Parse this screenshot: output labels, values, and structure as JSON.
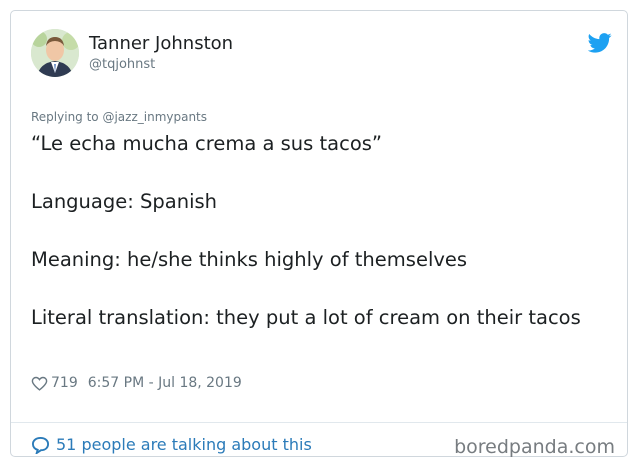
{
  "tweet": {
    "author_name": "Tanner Johnston",
    "author_handle": "@tqjohnst",
    "reply_to": "Replying to @jazz_inmypants",
    "lines": [
      "“Le echa mucha crema a sus tacos”",
      "Language: Spanish",
      "Meaning: he/she thinks highly of themselves",
      "Literal translation: they put a lot of cream on their tacos"
    ],
    "likes": "719",
    "timestamp": "6:57 PM - Jul 18, 2019",
    "talking": "51 people are talking about this"
  },
  "watermark": "boredpanda.com",
  "icons": {
    "brand": "twitter-bird-icon",
    "like": "heart-icon",
    "reply": "speech-bubble-icon"
  },
  "colors": {
    "twitter_blue": "#1da1f2",
    "link_blue": "#2b7bb9",
    "muted": "#697882"
  }
}
